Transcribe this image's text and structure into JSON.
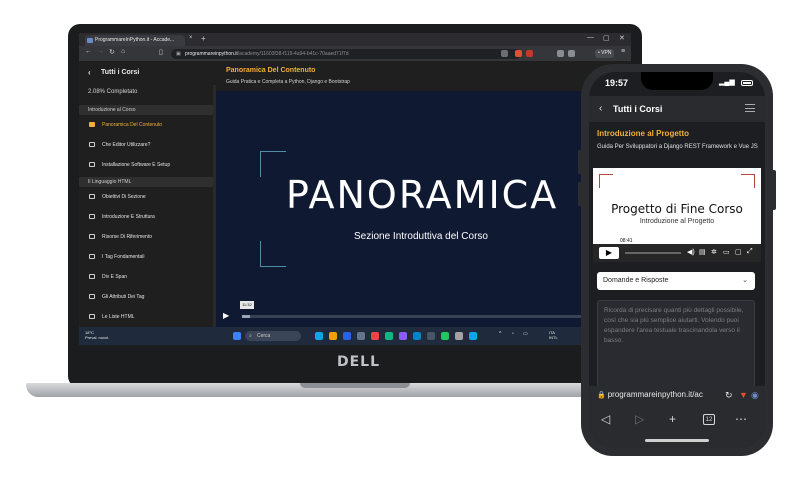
{
  "browser": {
    "tab_title": "ProgrammareInPython.it - Accade...",
    "tab_close": "×",
    "tab_new": "+",
    "url_host": "programmareinpython.it",
    "url_path": "/academy/11603f38-f119-4a94-b41c-70aaed71f7d",
    "vpn_label": "• VPN"
  },
  "sidebar": {
    "back": "‹",
    "heading": "Tutti i Corsi",
    "progress": "2.08% Completato",
    "sections": [
      {
        "title": "Introduzione al Corso"
      },
      {
        "title": "Il Linguaggio HTML"
      }
    ],
    "items": [
      {
        "label": "Panoramica Del Contenuto",
        "active": true
      },
      {
        "label": "Che Editor Utilizzare?"
      },
      {
        "label": "Installazione Software E Setup"
      },
      {
        "label": "Obiettivi Di Sezione"
      },
      {
        "label": "Introduzione E Struttura"
      },
      {
        "label": "Risorse Di Riferimento"
      },
      {
        "label": "I Tag Fondamentali"
      },
      {
        "label": "Div E Span"
      },
      {
        "label": "Gli Attributi Dei Tag"
      },
      {
        "label": "Le Liste HTML"
      }
    ]
  },
  "content": {
    "title": "Panoramica Del Contenuto",
    "subtitle": "Guida Pratica e Completa a Python, Django e Bootstrap",
    "video_title": "PANORAMICA",
    "video_subtitle": "Sezione Introduttiva del Corso",
    "video_time": "11:32",
    "video_play": "▶",
    "video_progress": 0.02
  },
  "taskbar": {
    "weather_temp": "18°C",
    "weather_desc": "Preval. nuvol.",
    "search_label": "Cerca",
    "search_icon": "⌕",
    "tray_arrow": "^",
    "lang_top": "ITA",
    "lang_bottom": "INTL"
  },
  "laptop": {
    "brand": "DELL"
  },
  "phone": {
    "status_time": "19:57",
    "header_back": "‹",
    "header_title": "Tutti i Corsi",
    "course_title": "Introduzione al Progetto",
    "course_subtitle": "Guida Per Sviluppatori a Django REST Framework e Vue JS",
    "video_title": "Progetto di Fine Corso",
    "video_subtitle": "Introduzione al Progetto",
    "video_time": "08:41",
    "video_play": "▶",
    "select_value": "Domande e Risposte",
    "select_chevron": "⌄",
    "textarea_placeholder": "Ricorda di precisare quanti più dettagli possibile, così che sia più semplice aiutarti. Volendo puoi espandere l'area testuale trascinandola verso il basso.",
    "url": "programmareinpython.it/ac",
    "url_lock": "🔒",
    "url_reload": "↻",
    "tab_count": "12",
    "nav_back": "◁",
    "nav_forward": "▷",
    "nav_new": "+",
    "nav_more": "⋯"
  },
  "colors": {
    "accent": "#f2b036",
    "video_bg": "#0f1932",
    "frame_teal": "#4e8fa6",
    "frame_red": "#b2473d"
  }
}
